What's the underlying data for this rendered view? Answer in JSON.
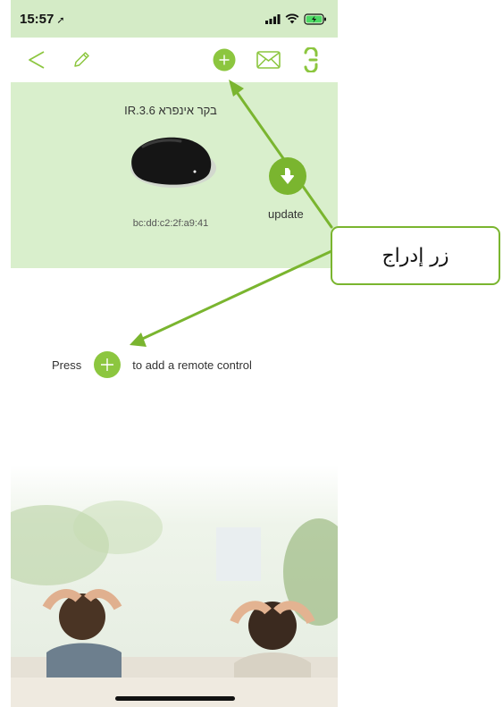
{
  "status_bar": {
    "time": "15:57",
    "location_glyph": "➚",
    "icons": [
      "signal-icon",
      "wifi-icon",
      "battery-charging-icon"
    ]
  },
  "nav": {
    "icons": [
      "back-icon",
      "edit-icon",
      "add-icon",
      "mail-icon",
      "more-icon"
    ]
  },
  "device": {
    "name": "בקר אינפרא IR.3.6",
    "mac": "bc:dd:c2:2f:a9:41",
    "update_label": "update"
  },
  "hint": {
    "before": "Press",
    "after": "to add a remote control"
  },
  "callout": {
    "text": "زر إدراج"
  },
  "colors": {
    "accent": "#8cc63f",
    "accent_dark": "#7ab52f",
    "panel": "#d9efcc",
    "status_bar": "#d4ebc6"
  }
}
